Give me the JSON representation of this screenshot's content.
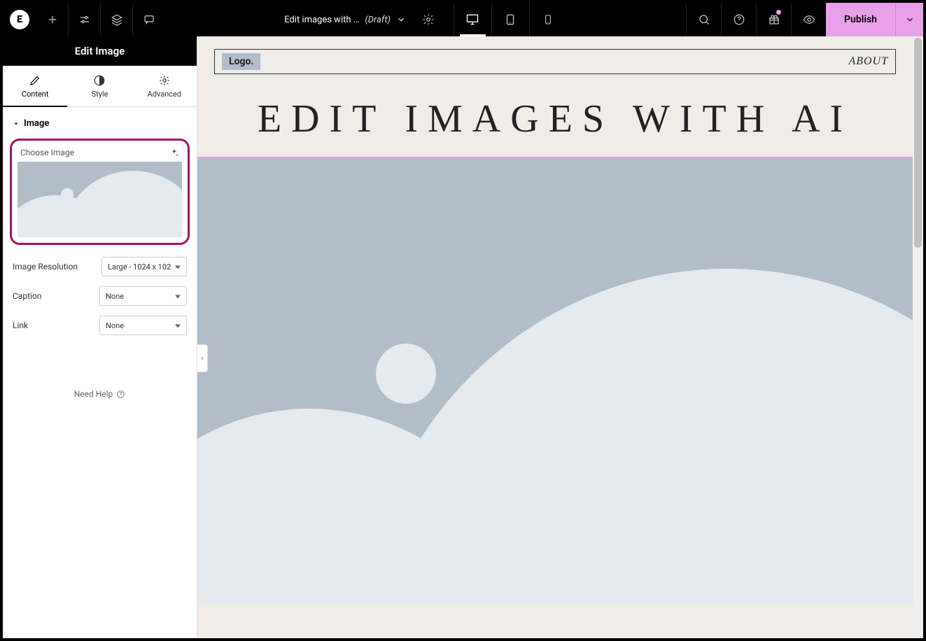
{
  "topbar": {
    "title": "Edit images with …",
    "draft": "(Draft)",
    "publish": "Publish"
  },
  "sidebar": {
    "header": "Edit Image",
    "tabs": {
      "content": "Content",
      "style": "Style",
      "advanced": "Advanced"
    },
    "section": "Image",
    "choose_image": "Choose Image",
    "fields": {
      "resolution_label": "Image Resolution",
      "resolution_value": "Large - 1024 x 102",
      "caption_label": "Caption",
      "caption_value": "None",
      "link_label": "Link",
      "link_value": "None"
    },
    "help": "Need Help"
  },
  "canvas": {
    "logo": "Logo.",
    "about": "ABOUT",
    "hero": "EDIT IMAGES WITH AI"
  }
}
